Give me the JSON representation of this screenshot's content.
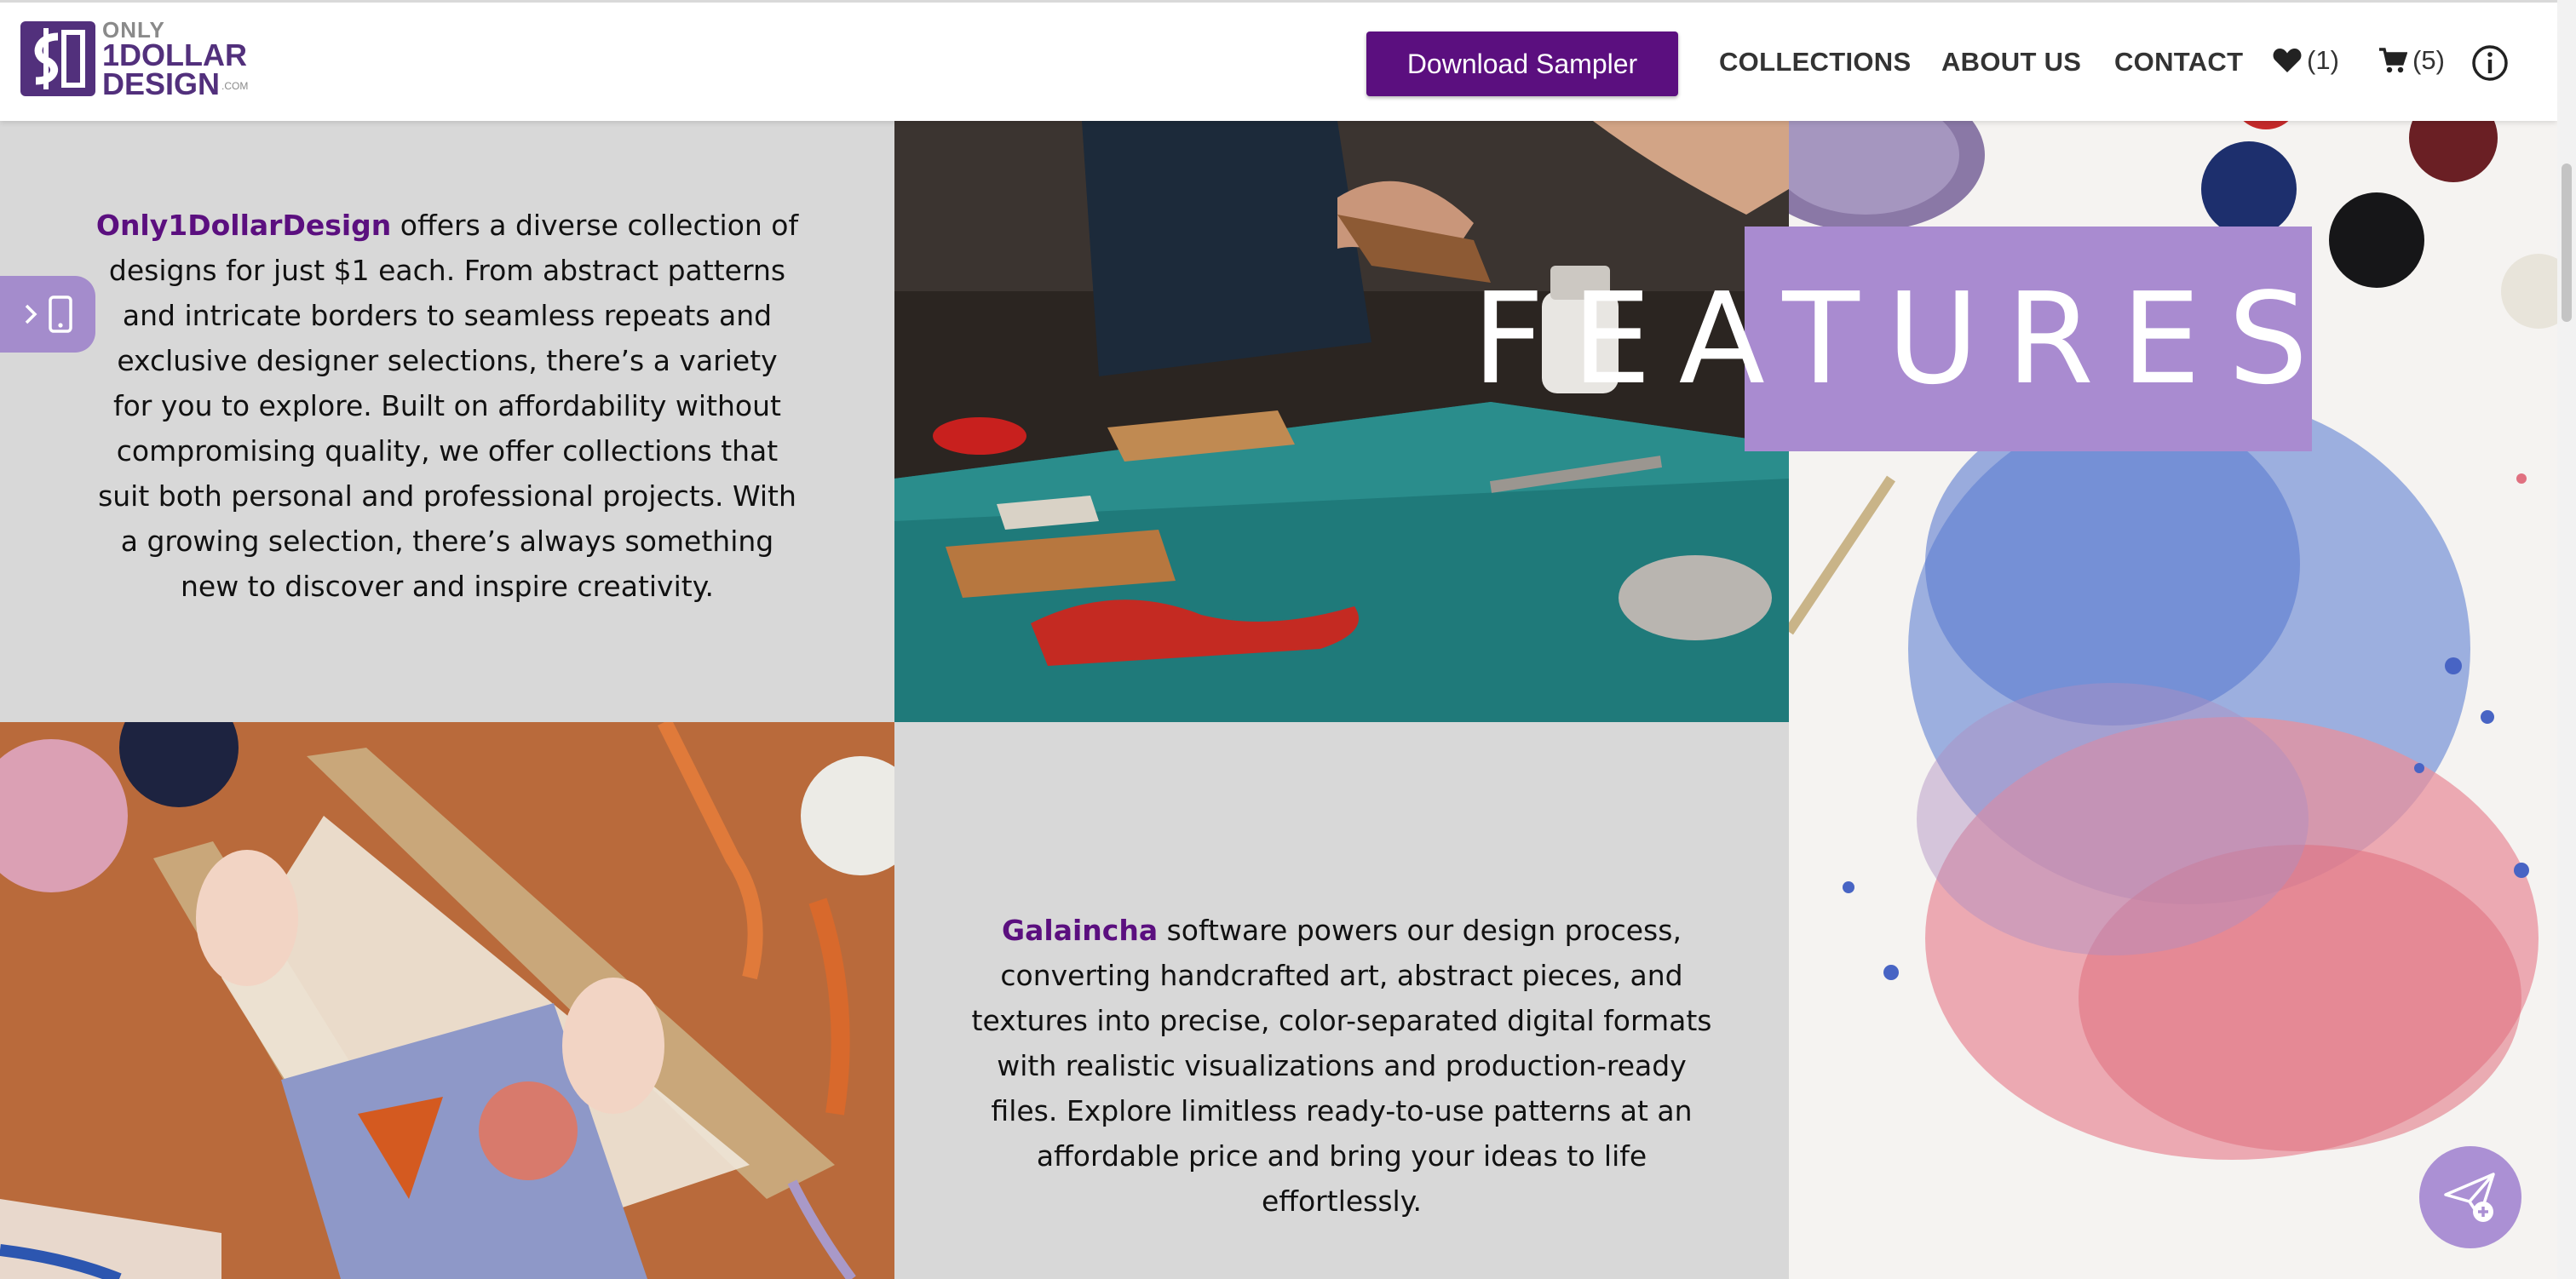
{
  "logo": {
    "line1": "ONLY",
    "line2": "1DOLLAR",
    "line3": "DESIGN",
    "suffix": ".COM",
    "mark": "$1"
  },
  "header": {
    "sampler_button": "Download Sampler",
    "nav": [
      "COLLECTIONS",
      "ABOUT US",
      "CONTACT"
    ],
    "wishlist_count": "(1)",
    "cart_count": "(5)",
    "icons": {
      "wishlist": "heart-icon",
      "cart": "cart-icon",
      "info": "info-icon"
    }
  },
  "intro": {
    "brand": "Only1DollarDesign",
    "text": " offers a diverse collection of designs for just $1 each. From abstract patterns and intricate borders to seamless repeats and exclusive designer selections, there’s a variety for you to explore. Built on affordability without compromising quality, we offer collections that suit both personal and professional projects. With a growing selection, there’s always something new to discover and inspire creativity."
  },
  "software": {
    "brand": "Galaincha",
    "text": " software powers our design process, converting handcrafted art, abstract pieces, and textures into precise, color-separated digital formats with realistic visualizations and production-ready files. Explore limitless ready-to-use patterns at an affordable price and bring your ideas to life effortlessly."
  },
  "features": {
    "title": "FEATURES"
  },
  "widgets": {
    "side_tab_icons": [
      "chevron-right-icon",
      "mobile-icon"
    ],
    "fab_icon": "send-plus-icon"
  },
  "colors": {
    "brand_purple": "#5b0f7f",
    "logo_purple": "#52307c",
    "features_box": "#a98bd0",
    "tile_grey": "#d8d8d8"
  }
}
